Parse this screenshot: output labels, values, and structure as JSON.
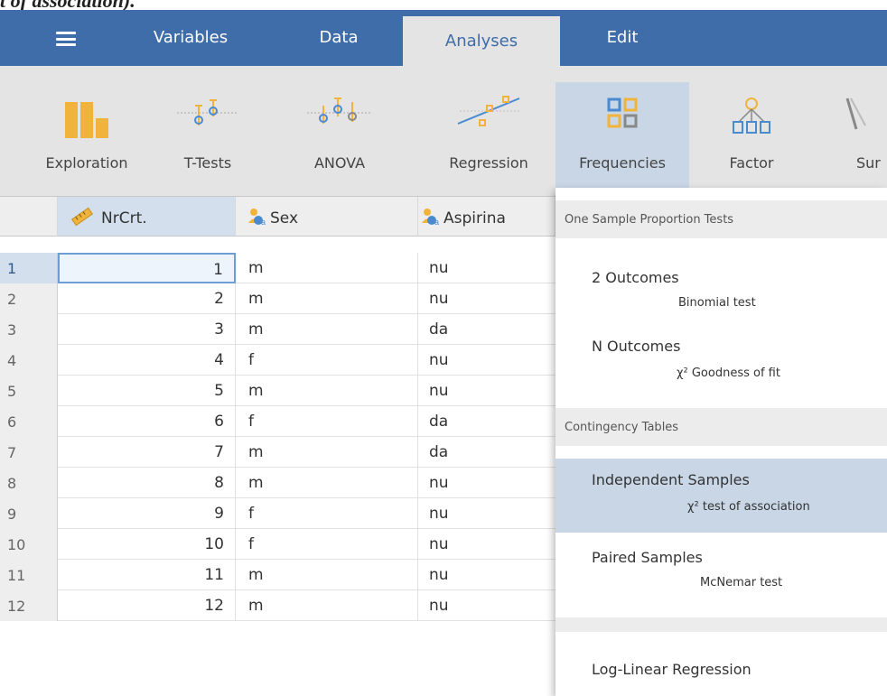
{
  "caption": "t of association).",
  "menubar": {
    "tabs": [
      {
        "label": "Variables"
      },
      {
        "label": "Data"
      },
      {
        "label": "Analyses"
      },
      {
        "label": "Edit"
      }
    ],
    "active_tab": "Analyses"
  },
  "ribbon": {
    "buttons": [
      {
        "label": "Exploration",
        "icon": "exploration-bars-icon"
      },
      {
        "label": "T-Tests",
        "icon": "ttest-icon"
      },
      {
        "label": "ANOVA",
        "icon": "anova-icon"
      },
      {
        "label": "Regression",
        "icon": "regression-icon"
      },
      {
        "label": "Frequencies",
        "icon": "frequencies-icon"
      },
      {
        "label": "Factor",
        "icon": "factor-icon"
      },
      {
        "label": "Sur",
        "icon": "survival-icon"
      }
    ],
    "active": "Frequencies"
  },
  "grid": {
    "columns": [
      {
        "name": "NrCrt.",
        "icon": "continuous-ruler-icon"
      },
      {
        "name": "Sex",
        "icon": "nominal-text-icon"
      },
      {
        "name": "Aspirina",
        "icon": "nominal-text-icon"
      }
    ],
    "rows": [
      {
        "n": "1",
        "nrcrt": "1",
        "sex": "m",
        "aspirina": "nu"
      },
      {
        "n": "2",
        "nrcrt": "2",
        "sex": "m",
        "aspirina": "nu"
      },
      {
        "n": "3",
        "nrcrt": "3",
        "sex": "m",
        "aspirina": "da"
      },
      {
        "n": "4",
        "nrcrt": "4",
        "sex": "f",
        "aspirina": "nu"
      },
      {
        "n": "5",
        "nrcrt": "5",
        "sex": "m",
        "aspirina": "nu"
      },
      {
        "n": "6",
        "nrcrt": "6",
        "sex": "f",
        "aspirina": "da"
      },
      {
        "n": "7",
        "nrcrt": "7",
        "sex": "m",
        "aspirina": "da"
      },
      {
        "n": "8",
        "nrcrt": "8",
        "sex": "m",
        "aspirina": "nu"
      },
      {
        "n": "9",
        "nrcrt": "9",
        "sex": "f",
        "aspirina": "nu"
      },
      {
        "n": "10",
        "nrcrt": "10",
        "sex": "f",
        "aspirina": "nu"
      },
      {
        "n": "11",
        "nrcrt": "11",
        "sex": "m",
        "aspirina": "nu"
      },
      {
        "n": "12",
        "nrcrt": "12",
        "sex": "m",
        "aspirina": "nu"
      }
    ]
  },
  "menu": {
    "section1": "One Sample Proportion Tests",
    "item1": {
      "title": "2 Outcomes",
      "subtitle": "Binomial test"
    },
    "item2": {
      "title": "N Outcomes",
      "subtitle": "χ² Goodness of fit"
    },
    "section2": "Contingency Tables",
    "item3": {
      "title": "Independent Samples",
      "subtitle": "χ² test of association"
    },
    "item4": {
      "title": "Paired Samples",
      "subtitle": "McNemar test"
    },
    "item5": {
      "title": "Log-Linear Regression"
    }
  },
  "colors": {
    "menubar": "#3e6da9",
    "ribbon": "#e4e4e4",
    "icon_orange": "#f0b43c",
    "icon_blue": "#4a8bd0",
    "selection": "#c8d6e6"
  }
}
